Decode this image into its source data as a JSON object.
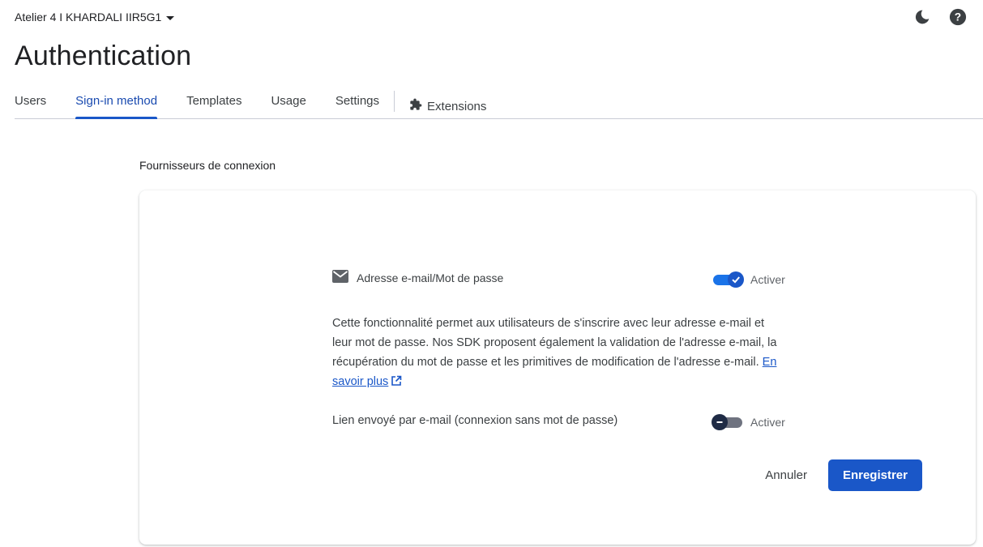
{
  "header": {
    "project_name": "Atelier 4 I KHARDALI IIR5G1",
    "theme_icon": "moon-icon",
    "help_icon": "help-icon"
  },
  "page": {
    "title": "Authentication"
  },
  "tabs": [
    {
      "label": "Users",
      "active": false
    },
    {
      "label": "Sign-in method",
      "active": true
    },
    {
      "label": "Templates",
      "active": false
    },
    {
      "label": "Usage",
      "active": false
    },
    {
      "label": "Settings",
      "active": false
    },
    {
      "label": "Extensions",
      "active": false,
      "icon": "puzzle-icon"
    }
  ],
  "section": {
    "title": "Fournisseurs de connexion"
  },
  "provider": {
    "icon": "mail-icon",
    "label": "Adresse e-mail/Mot de passe",
    "toggle_label": "Activer",
    "enabled": true,
    "description": "Cette fonctionnalité permet aux utilisateurs de s'inscrire avec leur adresse e-mail et leur mot de passe. Nos SDK proposent également la validation de l'adresse e-mail, la récupération du mot de passe et les primitives de modification de l'adresse e-mail.",
    "learn_more": "En savoir plus",
    "email_link_label": "Lien envoyé par e-mail (connexion sans mot de passe)",
    "email_link_toggle_label": "Activer",
    "email_link_enabled": false
  },
  "actions": {
    "cancel": "Annuler",
    "save": "Enregistrer"
  },
  "colors": {
    "accent": "#1a57c8",
    "toggle_on_track": "#1a73e8",
    "toggle_off_knob": "#1f2b45"
  }
}
